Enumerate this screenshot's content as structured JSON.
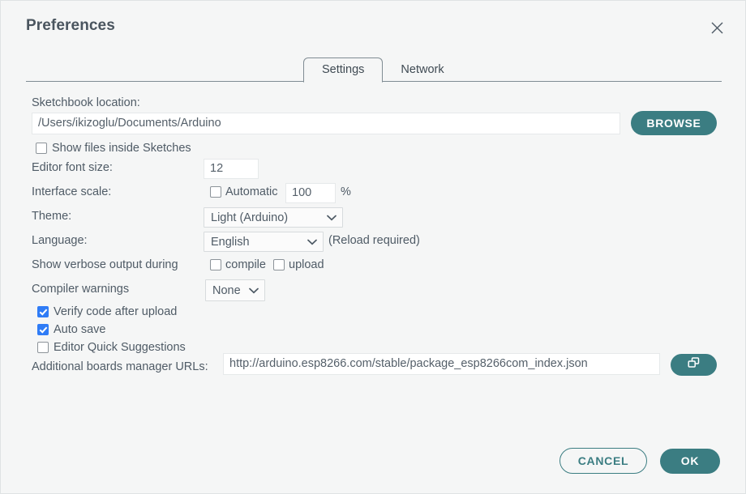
{
  "dialog": {
    "title": "Preferences",
    "close_icon": "close-icon"
  },
  "tabs": [
    {
      "label": "Settings",
      "active": true
    },
    {
      "label": "Network",
      "active": false
    }
  ],
  "settings": {
    "sketchbook": {
      "label": "Sketchbook location:",
      "value": "/Users/ikizoglu/Documents/Arduino",
      "browse_label": "BROWSE"
    },
    "show_files_inside_sketches": {
      "label": "Show files inside Sketches",
      "checked": false
    },
    "editor_font_size": {
      "label": "Editor font size:",
      "value": "12"
    },
    "interface_scale": {
      "label": "Interface scale:",
      "automatic_label": "Automatic",
      "automatic_checked": false,
      "value": "100",
      "unit": "%"
    },
    "theme": {
      "label": "Theme:",
      "value": "Light (Arduino)"
    },
    "language": {
      "label": "Language:",
      "value": "English",
      "note": "(Reload required)"
    },
    "verbose_output": {
      "label": "Show verbose output during",
      "compile_label": "compile",
      "compile_checked": false,
      "upload_label": "upload",
      "upload_checked": false
    },
    "compiler_warnings": {
      "label": "Compiler warnings",
      "value": "None"
    },
    "verify_code": {
      "label": "Verify code after upload",
      "checked": true
    },
    "auto_save": {
      "label": "Auto save",
      "checked": true
    },
    "quick_suggestions": {
      "label": "Editor Quick Suggestions",
      "checked": false
    },
    "boards_manager_urls": {
      "label": "Additional boards manager URLs:",
      "value": "http://arduino.esp8266.com/stable/package_esp8266com_index.json",
      "expand_icon": "open-windows-icon"
    }
  },
  "footer": {
    "cancel_label": "CANCEL",
    "ok_label": "OK"
  },
  "colors": {
    "accent_teal": "#3b7d82",
    "checkbox_blue": "#2f7cf6",
    "background": "#f5f6f6",
    "text": "#4f5b66"
  }
}
